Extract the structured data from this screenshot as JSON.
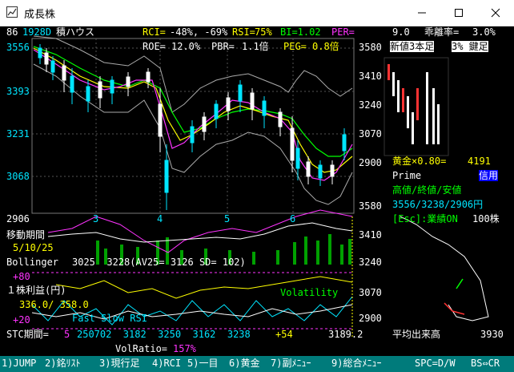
{
  "window": {
    "title": "成長株",
    "controls": [
      "minimize",
      "maximize",
      "close"
    ]
  },
  "stock": {
    "index": "86",
    "code": "1928D",
    "name": "積ハウス",
    "rci_label": "RCI=",
    "rci_values": "-48%, -69%",
    "rsi_label": "RSI=",
    "rsi_value": "75%",
    "bi_label": "BI=1.02",
    "per_label": "PER=",
    "roe_label": "ROE=",
    "roe_value": "12.0%",
    "pbr_label": "PBR=",
    "pbr_value": "1.1倍",
    "peg_label": "PEG=",
    "peg_value": "0.8倍"
  },
  "main_chart": {
    "y_left": [
      "3556",
      "3393",
      "3231",
      "3068",
      "2906"
    ],
    "y_right": [
      "3580",
      "3410",
      "3240",
      "3070",
      "2900",
      "3580"
    ],
    "x_months": [
      "3",
      "4",
      "5",
      "6"
    ]
  },
  "side_panel": {
    "per_value": "9.0",
    "kairi_label": "乖離率=",
    "kairi_value": "3.0%",
    "new3_label": "新値3本足",
    "kagi_label": "3% 鍵足",
    "gold_label": "黄金×0.80=",
    "gold_value": "4191",
    "prime_label": "Prime",
    "credit_label": "信用",
    "hlc_label": "高値/終値/安値",
    "hlc_values": "3556/3238/2906円",
    "esc_label": "[Esc]:業績ON",
    "unit_label": "100株",
    "volume_label": "平均出来高",
    "volume_value": "3930",
    "lower_axis": [
      "3410",
      "3240",
      "3070",
      "2900"
    ]
  },
  "lower_panels": {
    "ma_label": "移動期間",
    "ma_periods": "5/10/25",
    "bollinger_label": "Bollinger",
    "bollinger_values": "3025  3228(AV25= 3126 SD= 102)",
    "plus80": "+80",
    "eps_label": "１株利益(円)",
    "eps_values": "336.0/ 358.0",
    "volatility_label": "Volatility",
    "fast_slow": "Fast Slow RSI",
    "plus20": "+20",
    "stc_label": "STC期間=",
    "stc_period": "5",
    "stc_values": "250702  3182  3250  3162  3238",
    "stc_change": "+54",
    "stc_last": "3189.2",
    "volratio_label": "VolRatio=",
    "volratio_value": "157%"
  },
  "menu": {
    "items": [
      "1)JUMP",
      "2)銘ﾘｽﾄ",
      "3)現行足",
      "4)RCI",
      "5)一目",
      "6)黄金",
      "7)副ﾒﾆｭｰ",
      "9)総合ﾒﾆｭｰ",
      "SPC=D/W",
      "BS⇔CR"
    ]
  },
  "colors": {
    "background": "#000000",
    "statusbar": "#007b7b",
    "candle_up": "#00e5ff",
    "candle_down": "#ffffff",
    "ma_short": "#ff33ff",
    "ma_mid": "#ffff00",
    "ma_long": "#00ff00"
  }
}
